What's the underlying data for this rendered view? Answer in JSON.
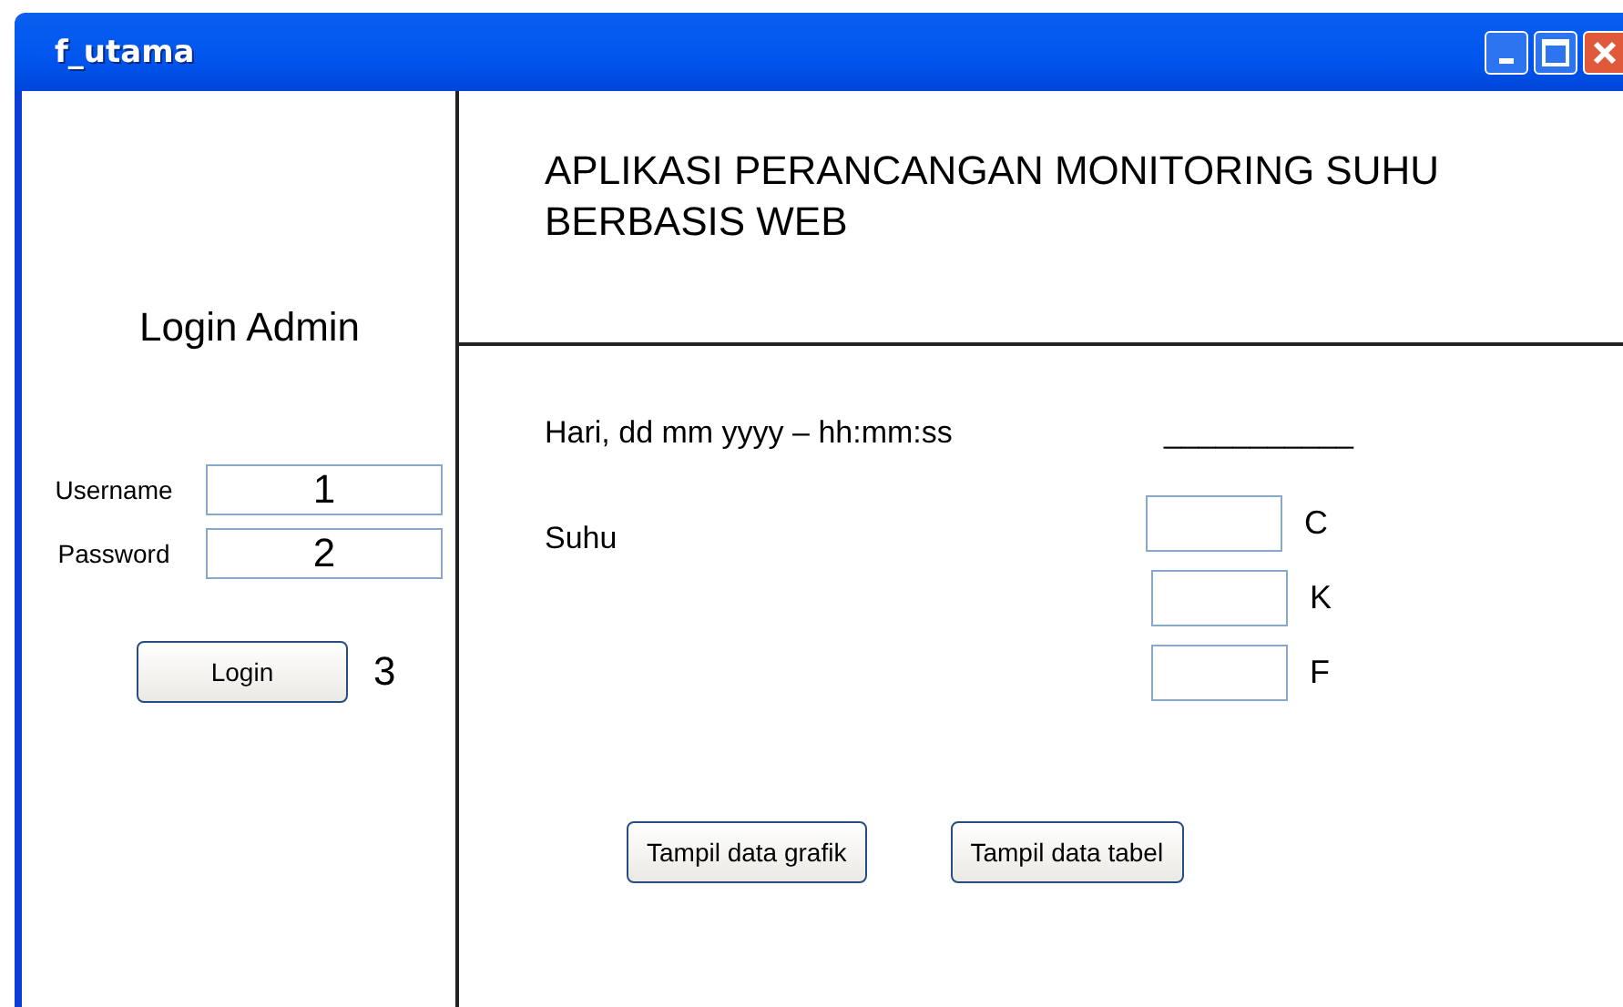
{
  "window": {
    "title": "f_utama"
  },
  "login": {
    "heading": "Login Admin",
    "fields": [
      {
        "label": "Username",
        "value": "1"
      },
      {
        "label": "Password",
        "value": "2"
      }
    ],
    "button": "Login",
    "button_note": "3"
  },
  "header": {
    "title": "APLIKASI PERANCANGAN MONITORING SUHU BERBASIS WEB"
  },
  "datetime": {
    "label": "Hari, dd mm yyyy – hh:mm:ss",
    "value": "___________"
  },
  "temperature": {
    "label": "Suhu",
    "units": [
      {
        "unit": "C"
      },
      {
        "unit": "K"
      },
      {
        "unit": "F"
      }
    ]
  },
  "buttons": [
    "Tampil data grafik",
    "Tampil data tabel"
  ]
}
